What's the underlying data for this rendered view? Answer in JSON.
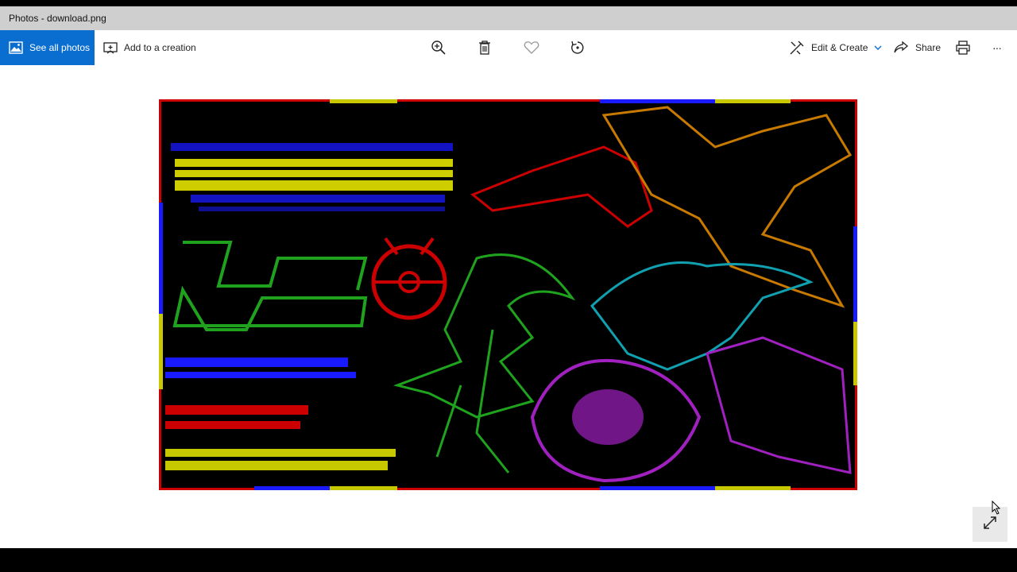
{
  "window": {
    "title": "Photos - download.png"
  },
  "toolbar": {
    "see_all_photos": "See all photos",
    "add_to_creation": "Add to a creation",
    "edit_create": "Edit & Create",
    "share": "Share",
    "more": "···"
  },
  "icons": {
    "see_all": "photos-icon",
    "add": "add-creation-icon",
    "zoom": "zoom-in-icon",
    "delete": "trash-icon",
    "favorite": "heart-icon",
    "rotate": "rotate-icon",
    "edit": "edit-create-icon",
    "share": "share-icon",
    "print": "print-icon",
    "expand": "expand-icon"
  },
  "colors": {
    "accent": "#0a6ed1",
    "titlebar": "#cfcfcf",
    "frame_red": "#cc0000",
    "frame_blue": "#1a1aff",
    "frame_yellow": "#c8c800",
    "art_green": "#1fa31f",
    "art_cyan": "#10a0b0",
    "art_magenta": "#a020c0",
    "art_orange": "#c87a00"
  }
}
